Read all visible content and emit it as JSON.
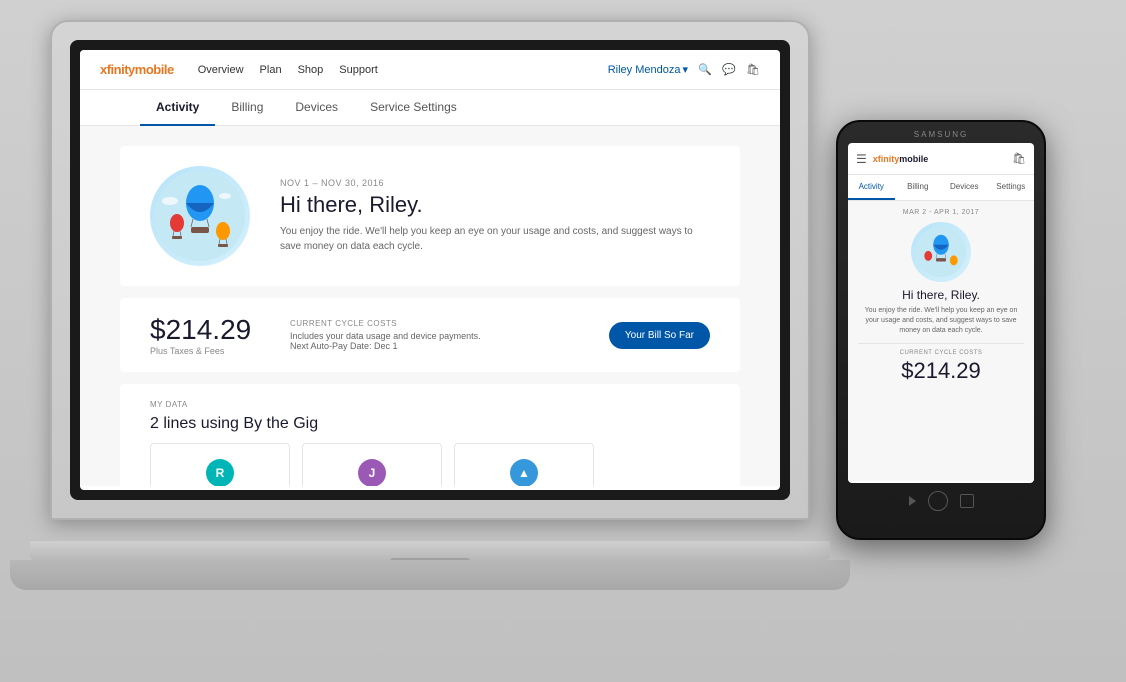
{
  "scene": {
    "background_color": "#d8d8d8"
  },
  "laptop": {
    "screen": {
      "navbar": {
        "logo": "xfinitymobile",
        "logo_accent": "xfinity",
        "nav_links": [
          "Overview",
          "Plan",
          "Shop",
          "Support"
        ],
        "user_name": "Riley Mendoza",
        "user_name_chevron": "▾"
      },
      "tabs": {
        "items": [
          {
            "label": "Activity",
            "active": true
          },
          {
            "label": "Billing",
            "active": false
          },
          {
            "label": "Devices",
            "active": false
          },
          {
            "label": "Service Settings",
            "active": false
          }
        ]
      },
      "hero": {
        "date_range": "NOV 1 – NOV 30, 2016",
        "greeting": "Hi there, Riley.",
        "subtitle": "You enjoy the ride. We'll help you keep an eye on your usage and costs, and suggest ways to save money on data each cycle."
      },
      "billing": {
        "amount": "$214.29",
        "plus_taxes": "Plus Taxes & Fees",
        "current_label": "CURRENT CYCLE COSTS",
        "description": "Includes your data usage and device payments.",
        "autopay": "Next Auto-Pay Date: Dec 1",
        "button_label": "Your Bill So Far"
      },
      "my_data": {
        "section_label": "MY DATA",
        "lines_text": "2 lines using By the Gig",
        "avatars": [
          {
            "letter": "R",
            "color": "teal"
          },
          {
            "letter": "J",
            "color": "purple"
          },
          {
            "letter": "▲",
            "color": "blue"
          }
        ]
      }
    }
  },
  "phone": {
    "brand": "SAMSUNG",
    "screen": {
      "navbar": {
        "logo": "xfinitymobile",
        "logo_accent": "xfinity"
      },
      "tabs": {
        "items": [
          {
            "label": "Activity",
            "active": true
          },
          {
            "label": "Billing",
            "active": false
          },
          {
            "label": "Devices",
            "active": false
          },
          {
            "label": "Settings",
            "active": false
          }
        ]
      },
      "content": {
        "date_range": "MAR 2 - APR 1, 2017",
        "greeting": "Hi there, Riley.",
        "subtitle": "You enjoy the ride. We'll help you keep an eye on your usage and costs, and suggest ways to save money on data each cycle.",
        "billing_label": "CURRENT CYCLE COSTS",
        "amount": "$214.29"
      }
    }
  }
}
